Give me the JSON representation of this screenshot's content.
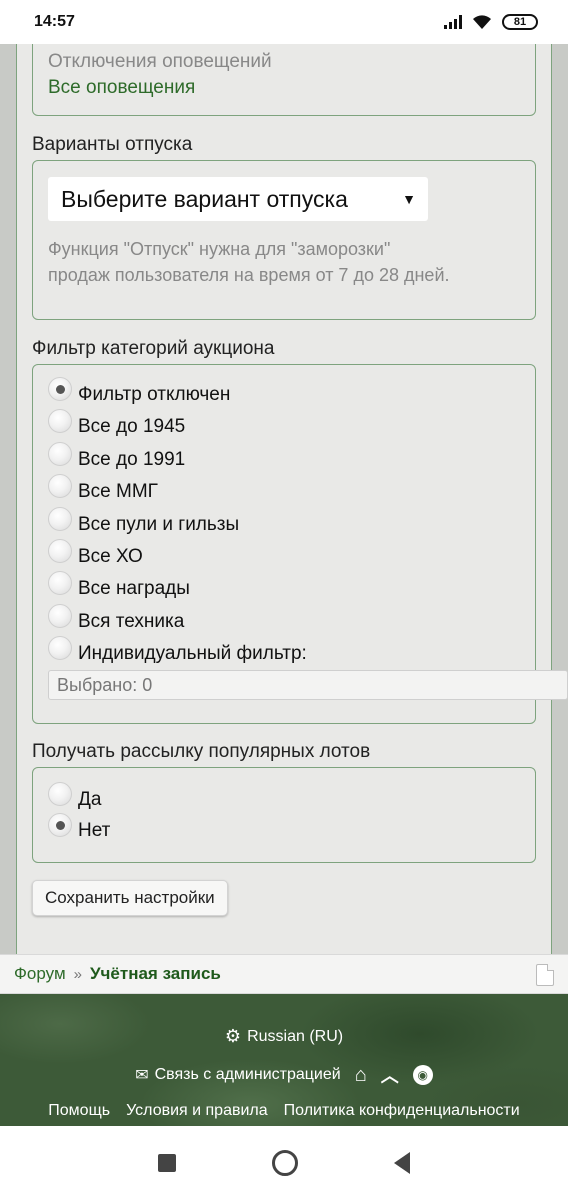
{
  "statusbar": {
    "time": "14:57",
    "battery": "81"
  },
  "notifications": {
    "partial_text": "Отключения оповещений",
    "all_link": "Все оповещения"
  },
  "vacation": {
    "legend": "Варианты отпуска",
    "select_value": "Выберите вариант отпуска",
    "hint_line1": "Функция \"Отпуск\" нужна для \"заморозки\"",
    "hint_line2": "продаж пользователя на время от 7 до 28 дней."
  },
  "auction_filter": {
    "legend": "Фильтр категорий аукциона",
    "options": [
      {
        "label": "Фильтр отключен",
        "checked": true
      },
      {
        "label": "Все до 1945",
        "checked": false
      },
      {
        "label": "Все до 1991",
        "checked": false
      },
      {
        "label": "Все ММГ",
        "checked": false
      },
      {
        "label": "Все пули и гильзы",
        "checked": false
      },
      {
        "label": "Все ХО",
        "checked": false
      },
      {
        "label": "Все награды",
        "checked": false
      },
      {
        "label": "Вся техника",
        "checked": false
      },
      {
        "label": "Индивидуальный фильтр:",
        "checked": false
      }
    ],
    "selected_count": "Выбрано: 0"
  },
  "newsletter": {
    "legend": "Получать рассылку популярных лотов",
    "options": [
      {
        "label": "Да",
        "checked": false
      },
      {
        "label": "Нет",
        "checked": true
      }
    ]
  },
  "save_button": "Сохранить настройки",
  "breadcrumb": {
    "forum": "Форум",
    "separator": "»",
    "current": "Учётная запись"
  },
  "footer": {
    "language": "Russian (RU)",
    "contact": "Связь с администрацией",
    "help": "Помощь",
    "terms": "Условия и правила",
    "privacy": "Политика конфиденциальности"
  },
  "colors": {
    "accent_green": "#2e6b2a",
    "footer_bg": "#3d5a38",
    "border_green": "#7ea37e"
  }
}
